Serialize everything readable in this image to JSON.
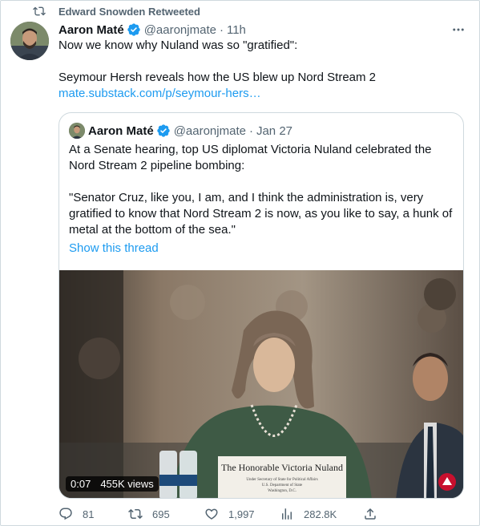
{
  "social_context": {
    "label": "Edward Snowden Retweeted",
    "icon": "retweet-icon"
  },
  "tweet": {
    "author_name": "Aaron Maté",
    "handle": "@aaronjmate",
    "separator": "·",
    "time": "11h",
    "line1": "Now we know why Nuland was so \"gratified\":",
    "line2": "Seymour Hersh reveals how the US blew up Nord Stream 2",
    "link": "mate.substack.com/p/seymour-hers…"
  },
  "quote": {
    "author_name": "Aaron Maté",
    "handle": "@aaronjmate",
    "separator": "·",
    "date": "Jan 27",
    "text1": "At a Senate hearing, top US diplomat Victoria Nuland celebrated the Nord Stream 2 pipeline bombing:",
    "text2": "\"Senator Cruz, like you, I am, and I think the administration is, very gratified to know that Nord Stream 2 is now, as you like to say, a hunk of metal at the bottom of the sea.\"",
    "show_thread": "Show this thread",
    "video": {
      "duration": "0:07",
      "views": "455K views",
      "placard_line1": "The Honorable Victoria Nuland",
      "placard_line2": "Under Secretary of State for Political Affairs",
      "placard_line3": "U.S. Department of State",
      "placard_line4": "Washington, D.C."
    }
  },
  "actions": {
    "replies": "81",
    "retweets": "695",
    "likes": "1,997",
    "views": "282.8K"
  },
  "colors": {
    "accent": "#1d9bf0",
    "muted": "#536471",
    "text": "#0f1419",
    "border": "#cfd9de"
  }
}
